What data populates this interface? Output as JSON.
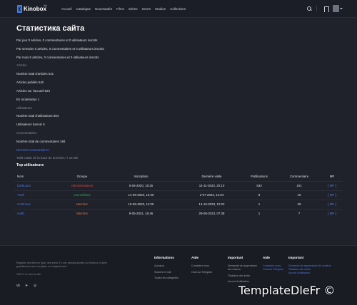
{
  "header": {
    "logo_text": "Kinobox",
    "logo_sup": "dle",
    "nav": [
      "Accueil",
      "Catalogue",
      "Nouveautés",
      "Films",
      "Séries",
      "Genre",
      "Studios",
      "Collections"
    ]
  },
  "page": {
    "title": "Статистика сайта",
    "stats": [
      {
        "text": "Par jour 0 articles, 0 commentaires et 0 utilisateurs inscrits",
        "style": "normal"
      },
      {
        "text": "Par semaine 0 articles, 0 commentaires et 0 utilisateurs inscrits",
        "style": "normal"
      },
      {
        "text": "Par mois 5 articles, 0 commentaires et 0 utilisateurs inscrits",
        "style": "normal"
      },
      {
        "text": "Articles",
        "style": "muted"
      },
      {
        "text": "Nombre total d'articles 541",
        "style": "normal"
      },
      {
        "text": "Articles publiés 540",
        "style": "normal"
      },
      {
        "text": "Articles sur l'accueil 524",
        "style": "normal"
      },
      {
        "text": "En modération 1",
        "style": "normal"
      },
      {
        "text": "Utilisateurs",
        "style": "muted"
      },
      {
        "text": "Nombre total d'utilisateurs 594",
        "style": "normal"
      },
      {
        "text": "Utilisateurs bannis 0",
        "style": "normal"
      },
      {
        "text": "Commentaires",
        "style": "muted"
      },
      {
        "text": "Nombre total de commentaires 284",
        "style": "normal"
      },
      {
        "text": "Derniers commentaires",
        "style": "link"
      },
      {
        "text": "Taille totale de la base de données: 7.16 Mb",
        "style": "muted"
      }
    ],
    "top_users_title": "Top utilisateurs",
    "table": {
      "columns": [
        "Nom",
        "Groupe",
        "Inscription",
        "Dernière visite",
        "Publications",
        "Commentaire",
        "MP"
      ],
      "rows": [
        {
          "name": "DarkLane",
          "group": "Administrateurs",
          "group_color": "#e0473f",
          "registered": "5-05-2020, 15:25",
          "last_visit": "14-11-2023, 20:10",
          "publications": "533",
          "comments": "101",
          "pm": "MP"
        },
        {
          "name": "Truth",
          "group": "Journalistes",
          "group_color": "#3aa655",
          "registered": "14-09-2020, 13:46",
          "last_visit": "2-07-2023, 14:04",
          "publications": "8",
          "comments": "16",
          "pm": "MP"
        },
        {
          "name": "Cortinous",
          "group": "Membre",
          "group_color": "#e8763a",
          "registered": "10-05-2020, 12:25",
          "last_visit": "14-10-2023, 12:22",
          "publications": "1",
          "comments": "29",
          "pm": "MP"
        },
        {
          "name": "reallz",
          "group": "Membre",
          "group_color": "#e8763a",
          "registered": "9-05-2021, 16:46",
          "last_visit": "29-06-2023, 07:38",
          "publications": "1",
          "comments": "7",
          "pm": "MP"
        }
      ]
    }
  },
  "footer": {
    "about": "Regarder des films en ligne, des séries TV, des dessins animés sur Kinobox en ligne gratuitement sans inscription ni enregistrement.",
    "copyright": "2023 © Le nom du site",
    "columns": [
      {
        "heading": "Informations",
        "items": [
          "A propos",
          "Soutenir le site",
          "Toutes les catégories"
        ]
      },
      {
        "heading": "Aide",
        "items": [
          "Contactez nous",
          "Chat sur Telegram"
        ]
      },
      {
        "heading": "Important",
        "items": [
          "Demande de suppression de contenu",
          "Titulaires des droits",
          "Accord d'utilisation"
        ]
      },
      {
        "heading": "Aide",
        "items": [
          "Contactez-nous",
          "Chat sur Telegram"
        ]
      },
      {
        "heading": "Important",
        "items": [
          "Demande de suppression de contenu",
          "Titulaires des droits",
          "Accord d'utilisation"
        ]
      }
    ]
  },
  "watermark": "TemplateDleFr ©"
}
